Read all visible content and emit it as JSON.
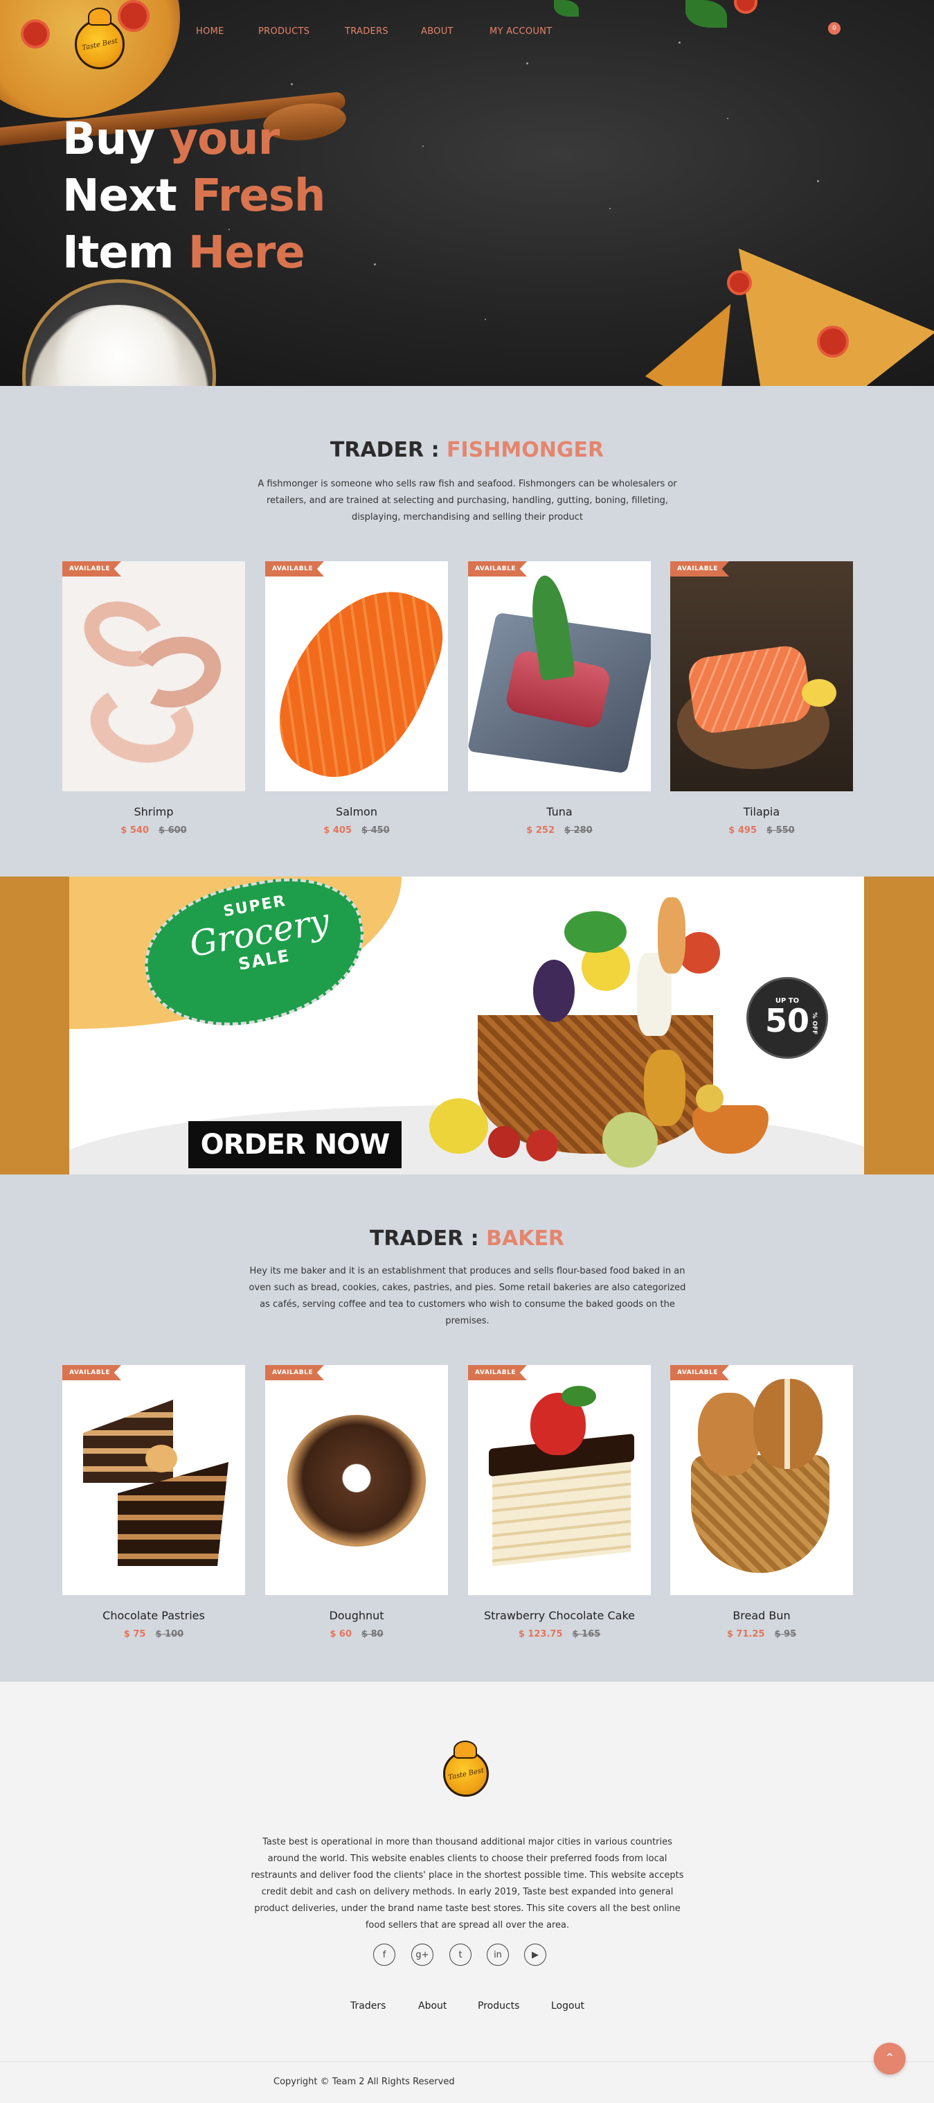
{
  "nav": {
    "items": [
      "HOME",
      "PRODUCTS",
      "TRADERS",
      "ABOUT",
      "MY ACCOUNT"
    ],
    "cart_count": "0",
    "logo_text": "Taste Best"
  },
  "hero": {
    "line1_a": "Buy ",
    "line1_b": "your",
    "line2_a": "Next ",
    "line2_b": "Fresh",
    "line3_a": "Item ",
    "line3_b": "Here"
  },
  "fish": {
    "title_prefix": "TRADER : ",
    "title_name": "FISHMONGER",
    "description": "A fishmonger is someone who sells raw fish and seafood. Fishmongers can be wholesalers or retailers, and are trained at selecting and purchasing, handling, gutting, boning, filleting, displaying, merchandising and selling their product",
    "products": [
      {
        "badge": "AVAILABLE",
        "name": "Shrimp",
        "price": "$ 540",
        "old_price": "$ 600"
      },
      {
        "badge": "AVAILABLE",
        "name": "Salmon",
        "price": "$ 405",
        "old_price": "$ 450"
      },
      {
        "badge": "AVAILABLE",
        "name": "Tuna",
        "price": "$ 252",
        "old_price": "$ 280"
      },
      {
        "badge": "AVAILABLE",
        "name": "Tilapia",
        "price": "$ 495",
        "old_price": "$ 550"
      }
    ]
  },
  "banner": {
    "tag_top": "SUPER",
    "tag_mid": "Grocery",
    "tag_bottom": "SALE",
    "cta": "ORDER NOW",
    "discount_upto": "UP TO",
    "discount_value": "50",
    "discount_off": "% OFF"
  },
  "baker": {
    "title_prefix": "TRADER : ",
    "title_name": "BAKER",
    "description": "Hey its me baker and it is an establishment that produces and sells flour-based food baked in an oven such as bread, cookies, cakes, pastries, and pies. Some retail bakeries are also categorized as cafés, serving coffee and tea to customers who wish to consume the baked goods on the premises.",
    "products": [
      {
        "badge": "AVAILABLE",
        "name": "Chocolate Pastries",
        "price": "$ 75",
        "old_price": "$ 100"
      },
      {
        "badge": "AVAILABLE",
        "name": "Doughnut",
        "price": "$ 60",
        "old_price": "$ 80"
      },
      {
        "badge": "AVAILABLE",
        "name": "Strawberry Chocolate Cake",
        "price": "$ 123.75",
        "old_price": "$ 165"
      },
      {
        "badge": "AVAILABLE",
        "name": "Bread Bun",
        "price": "$ 71.25",
        "old_price": "$ 95"
      }
    ]
  },
  "footer": {
    "description": "Taste best is operational in more than thousand additional major cities in various countries around the world. This website enables clients to choose their preferred foods from local restraunts and deliver food the clients' place in the shortest possible time. This website accepts credit debit and cash on delivery methods. In early 2019, Taste best expanded into general product deliveries, under the brand name taste best stores. This site covers all the best online food sellers that are spread all over the area.",
    "social": [
      {
        "icon": "facebook-icon",
        "glyph": "f"
      },
      {
        "icon": "google-plus-icon",
        "glyph": "g+"
      },
      {
        "icon": "tumblr-icon",
        "glyph": "t"
      },
      {
        "icon": "linkedin-icon",
        "glyph": "in"
      },
      {
        "icon": "youtube-icon",
        "glyph": "▶"
      }
    ],
    "links": [
      "Traders",
      "About",
      "Products",
      "Logout"
    ],
    "copyright": "Copyright © Team 2 All Rights Reserved"
  },
  "colors": {
    "accent": "#e5856e",
    "section_bg": "#d3d8df",
    "badge": "#d9744f",
    "banner_border": "#c98a33",
    "grocery_green": "#1e9e4a"
  }
}
